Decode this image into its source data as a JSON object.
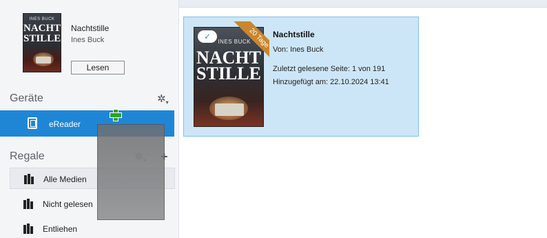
{
  "current_book": {
    "title": "Nachtstille",
    "author": "Ines Buck",
    "read_button": "Lesen",
    "cover": {
      "author": "INES BUCK",
      "title_line1": "NACHT",
      "title_line2": "STILLE"
    }
  },
  "devices": {
    "heading": "Geräte",
    "items": [
      {
        "label": "eReader",
        "icon": "ereader-icon"
      }
    ]
  },
  "shelves": {
    "heading": "Regale",
    "items": [
      {
        "label": "Alle Medien",
        "active": true
      },
      {
        "label": "Nicht gelesen",
        "active": false
      },
      {
        "label": "Entliehen",
        "active": false
      }
    ]
  },
  "library": {
    "book": {
      "title": "Nachtstille",
      "author_line": "Von:  Ines Buck",
      "last_page": "Zuletzt gelesene Seite:  1 von 191",
      "added": "Hinzugefügt am:  22.10.2024 13:41",
      "badge": "20 Tage",
      "cover": {
        "author": "INES BUCK",
        "title_line1": "NACHT",
        "title_line2": "STILLE"
      }
    }
  },
  "colors": {
    "selection": "#1f86d6",
    "card_background": "#cde6f7",
    "ribbon": "#c9862e",
    "drag_add": "#2ea12e"
  }
}
